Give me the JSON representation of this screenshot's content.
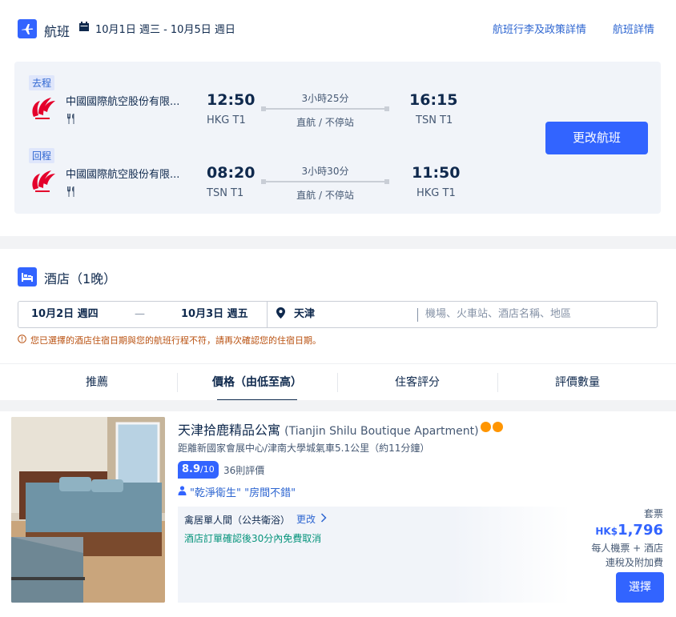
{
  "flight": {
    "title": "航班",
    "dates": "10月1日 週三 - 10月5日 週日",
    "baggage_link": "航班行李及政策詳情",
    "details_link": "航班詳情",
    "change_button": "更改航班",
    "legs": [
      {
        "tag": "去程",
        "airline": "中國國際航空股份有限...",
        "depart_time": "12:50",
        "depart_port": "HKG T1",
        "duration": "3小時25分",
        "stops": "直航 / 不停站",
        "arrive_time": "16:15",
        "arrive_port": "TSN T1"
      },
      {
        "tag": "回程",
        "airline": "中國國際航空股份有限...",
        "depart_time": "08:20",
        "depart_port": "TSN T1",
        "duration": "3小時30分",
        "stops": "直航 / 不停站",
        "arrive_time": "11:50",
        "arrive_port": "HKG T1"
      }
    ]
  },
  "hotel": {
    "title": "酒店（1晚）",
    "checkin": "10月2日 週四",
    "dash": "—",
    "checkout": "10月3日 週五",
    "city": "天津",
    "keyword_placeholder": "機場、火車站、酒店名稱、地區",
    "warning": "您已選擇的酒店住宿日期與您的航班行程不符，請再次確認您的住宿日期。",
    "sort_tabs": [
      "推薦",
      "價格（由低至高）",
      "住客評分",
      "評價數量"
    ],
    "active_sort": 1
  },
  "listing": {
    "name": "天津拾鹿精品公寓",
    "name_en": "(Tianjin Shilu Boutique Apartment)",
    "distance": "距離新國家會展中心/津南大學城氣車5.1公里（約11分鐘）",
    "score": "8.9",
    "score_max": "/10",
    "reviews": "36則評價",
    "quote": "\"乾淨衛生\" \"房間不錯\"",
    "room_name": "禽居單人間（公共衛浴）",
    "room_change": "更改",
    "free_cancel": "酒店訂單確認後30分內免費取消",
    "package_label": "套票",
    "currency": "HK$",
    "price": "1,796",
    "price_note1": "每人機票 + 酒店",
    "price_note2": "連稅及附加費",
    "select_button": "選擇"
  },
  "colors": {
    "accent": "#3264ff",
    "link": "#2e66d1",
    "warning": "#b95110",
    "free": "#06947c",
    "star": "#ff9500",
    "airline_red": "#e4002b"
  }
}
